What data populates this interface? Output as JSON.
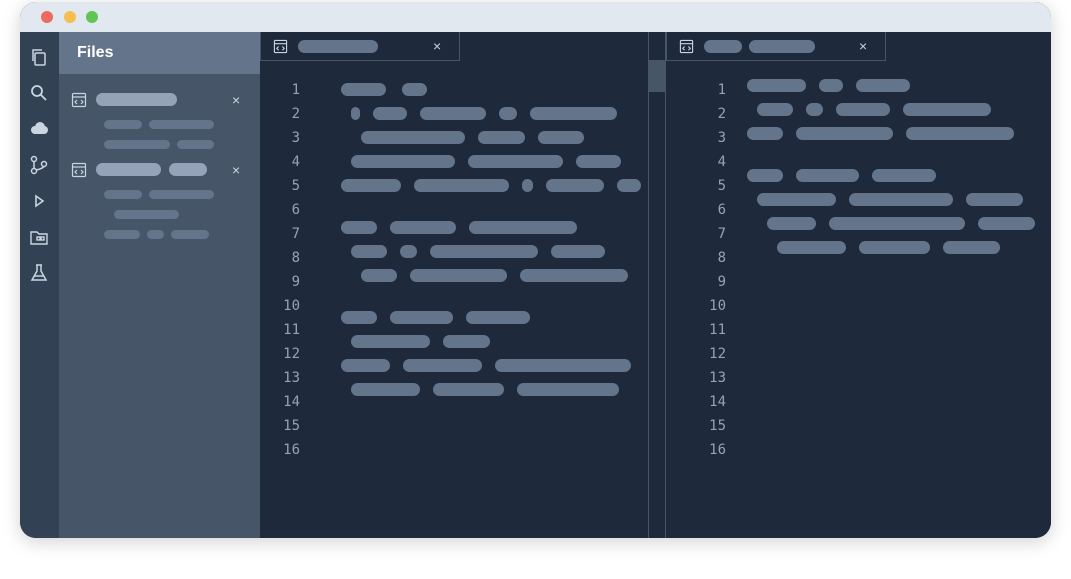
{
  "window": {
    "traffic_lights": {
      "close": "#ed6a5e",
      "minimize": "#f4bf4f",
      "zoom": "#61c554"
    }
  },
  "activity_bar": {
    "icons": [
      "copy-icon",
      "search-icon",
      "cloud-icon",
      "source-control-icon",
      "run-icon",
      "folder-icon",
      "flask-icon"
    ]
  },
  "sidebar": {
    "title": "Files",
    "close_glyph": "×"
  },
  "editor_left": {
    "tab_close": "×",
    "line_numbers": [
      "1",
      "2",
      "3",
      "4",
      "5",
      "6",
      "7",
      "8",
      "9",
      "10",
      "11",
      "12",
      "13",
      "14",
      "15",
      "16"
    ]
  },
  "editor_right": {
    "tab_close": "×",
    "line_numbers": [
      "1",
      "2",
      "3",
      "4",
      "5",
      "6",
      "7",
      "8",
      "9",
      "10",
      "11",
      "12",
      "13",
      "14",
      "15",
      "16"
    ]
  },
  "colors": {
    "editor_bg": "#1e293b",
    "sidebar_bg": "#475569",
    "sidebar_header": "#64748b",
    "placeholder": "#64748b",
    "line_number": "#94a3b8"
  }
}
